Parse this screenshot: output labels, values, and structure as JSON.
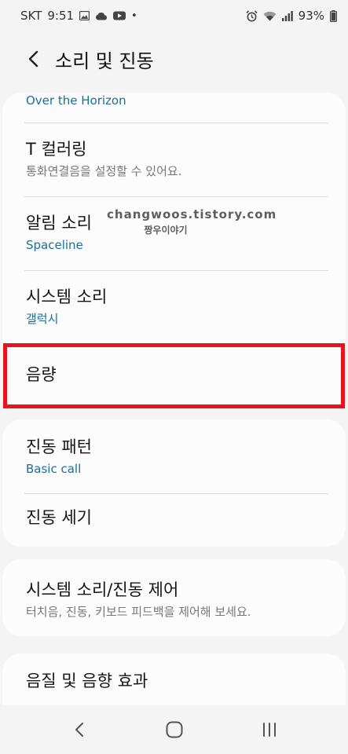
{
  "status_bar": {
    "carrier": "SKT",
    "time": "9:51",
    "dot": "•",
    "battery": "93%"
  },
  "header": {
    "title": "소리 및 진동"
  },
  "cards": {
    "sound": {
      "ringtone_value": "Over the Horizon",
      "t_coloring_title": "T 컬러링",
      "t_coloring_sub": "통화연결음을 설정할 수 있어요.",
      "notification_title": "알림 소리",
      "notification_value": "Spaceline",
      "system_sound_title": "시스템 소리",
      "system_sound_value": "갤럭시",
      "volume_title": "음량"
    },
    "vibration": {
      "pattern_title": "진동 패턴",
      "pattern_value": "Basic call",
      "intensity_title": "진동 세기"
    },
    "control": {
      "title": "시스템 소리/진동 제어",
      "sub": "터치음, 진동, 키보드 피드백을 제어해 보세요."
    },
    "quality": {
      "title": "음질 및 음향 효과"
    }
  },
  "watermark": {
    "url": "changwoos.tistory.com",
    "name": "짱우이야기"
  },
  "colors": {
    "accent_blue": "#1a6e9a",
    "highlight_red": "#e8141b",
    "background": "#f4f4f4",
    "card": "#fcfcfc"
  },
  "icons": {
    "status_left": [
      "gallery-icon",
      "cloud-icon",
      "youtube-icon"
    ],
    "status_right": [
      "alarm-icon",
      "wifi-icon",
      "signal-icon",
      "battery-icon"
    ],
    "nav": [
      "nav-back-icon",
      "nav-home-icon",
      "nav-recents-icon"
    ]
  }
}
